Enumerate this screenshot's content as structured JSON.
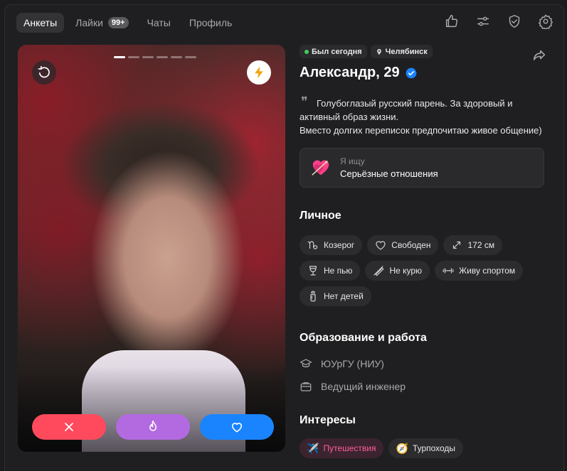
{
  "nav": {
    "tabs": [
      {
        "label": "Анкеты",
        "active": true
      },
      {
        "label": "Лайки",
        "badge": "99+"
      },
      {
        "label": "Чаты"
      },
      {
        "label": "Профиль"
      }
    ],
    "tools": [
      "thumbs-up-icon",
      "filters-icon",
      "shield-check-icon",
      "gear-icon"
    ]
  },
  "photo": {
    "slides": 6,
    "current": 1
  },
  "profile": {
    "status": "Был сегодня",
    "city": "Челябинск",
    "name": "Александр, 29",
    "verified": true,
    "bio_line1": "Голубоглазый русский парень. За здоровый и",
    "bio_line2": "активный образ жизни.",
    "bio_line3": "Вместо долгих переписок предпочитаю живое общение)",
    "seek_label": "Я ищу",
    "seek_value": "Серьёзные отношения"
  },
  "personal": {
    "title": "Личное",
    "pills": [
      {
        "icon": "capricorn-icon",
        "label": "Козерог"
      },
      {
        "icon": "heart-outline-icon",
        "label": "Свободен"
      },
      {
        "icon": "height-arrows-icon",
        "label": "172 см"
      },
      {
        "icon": "wine-glass-icon",
        "label": "Не пью"
      },
      {
        "icon": "no-smoking-icon",
        "label": "Не курю"
      },
      {
        "icon": "dumbbell-icon",
        "label": "Живу спортом"
      },
      {
        "icon": "baby-bottle-icon",
        "label": "Нет детей"
      }
    ]
  },
  "education": {
    "title": "Образование и работа",
    "university": "ЮУрГУ (НИУ)",
    "job": "Ведущий инженер"
  },
  "interests": {
    "title": "Интересы",
    "items": [
      {
        "emoji": "✈️",
        "label": "Путешествия",
        "highlight": true
      },
      {
        "emoji": "🧭",
        "label": "Турпоходы"
      }
    ]
  },
  "colors": {
    "accent_red": "#ff4a5e",
    "accent_purple": "#b36ae0",
    "accent_blue": "#1a84ff",
    "online": "#3ccf5b",
    "highlight_pink": "#ff5c9a"
  }
}
